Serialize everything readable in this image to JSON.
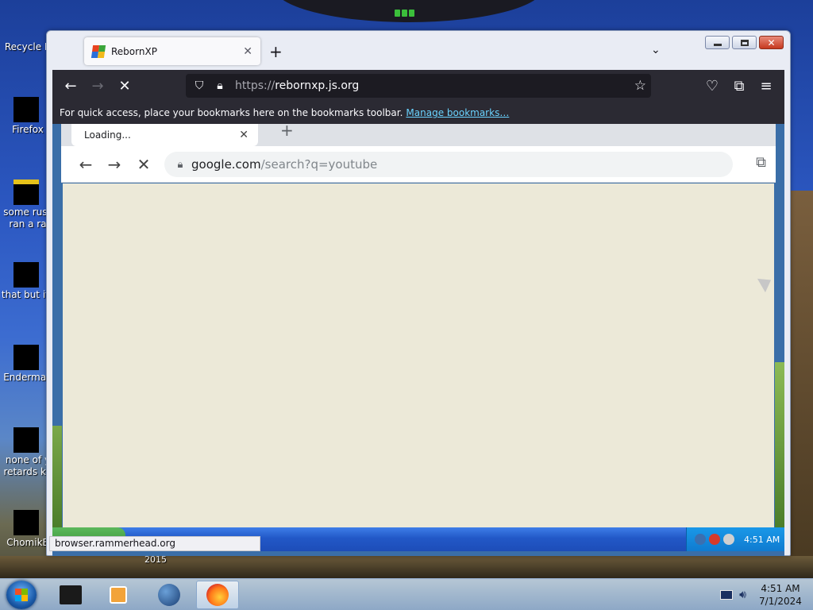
{
  "desktop": {
    "icons": [
      {
        "label": "Recycle B"
      },
      {
        "label": "Firefox"
      },
      {
        "label": "some russ\nran a ra"
      },
      {
        "label": "that but its"
      },
      {
        "label": "Enderman"
      },
      {
        "label": "none of y\nretards kn"
      },
      {
        "label": "ChomikB"
      }
    ],
    "year_label": "2015"
  },
  "firefox": {
    "tab_title": "RebornXP",
    "url_prefix": "https://",
    "url_domain": "rebornxp.js.org",
    "bookmarks_hint": "For quick access, place your bookmarks here on the bookmarks toolbar.",
    "bookmarks_link": "Manage bookmarks…",
    "status_url": "browser.rammerhead.org"
  },
  "inner_browser": {
    "tab_title": "Loading...",
    "url_host": "google.com",
    "url_path": "/search?q=youtube",
    "body_color": "#ece9d8",
    "xp_clock": "4:51 AM"
  },
  "taskbar": {
    "time": "4:51 AM",
    "date": "7/1/2024"
  },
  "colors": {
    "firefox_toolbar": "#2b2a33",
    "link": "#6ad3ff",
    "xp_taskbar": "#2258c7"
  }
}
